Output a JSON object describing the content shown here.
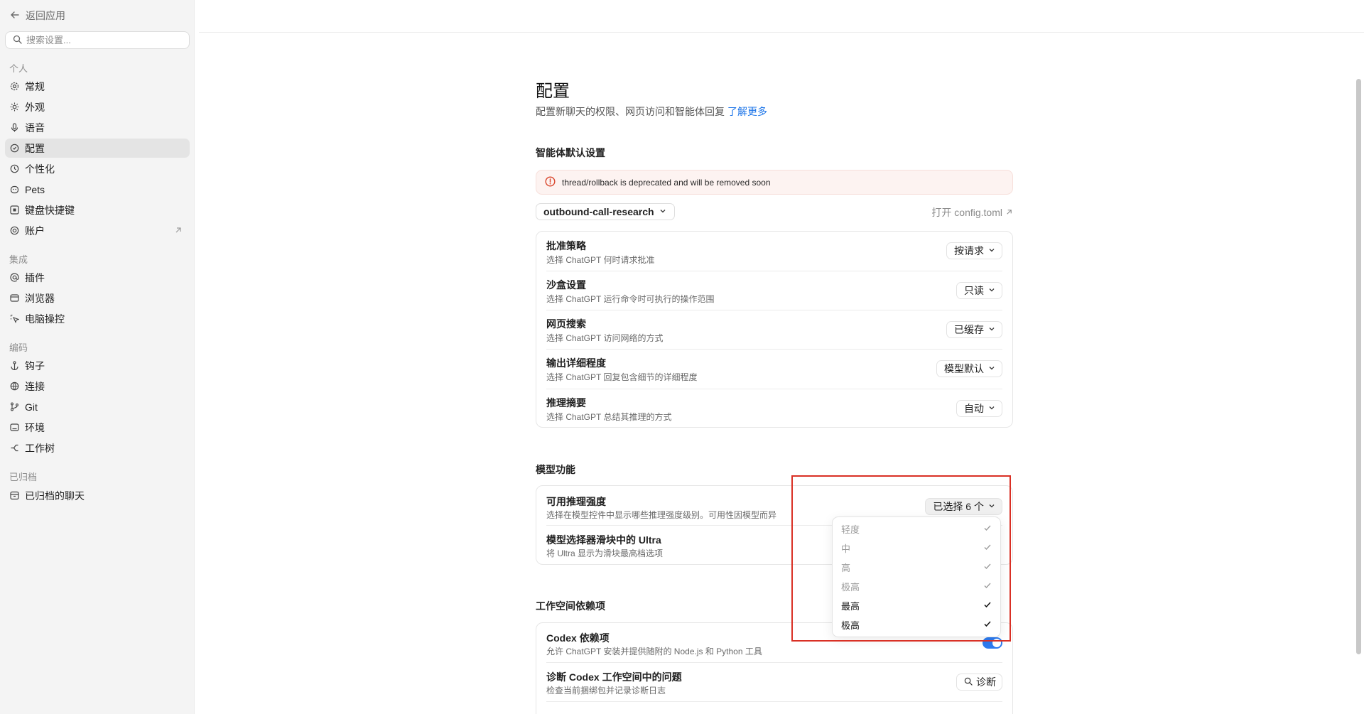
{
  "sidebar": {
    "back_label": "返回应用",
    "search_placeholder": "搜索设置...",
    "sections": {
      "personal": "个人",
      "integrations": "集成",
      "coding": "编码",
      "archived": "已归档"
    },
    "items": {
      "general": "常规",
      "appearance": "外观",
      "voice": "语音",
      "config": "配置",
      "personalization": "个性化",
      "pets": "Pets",
      "shortcuts": "键盘快捷键",
      "account": "账户",
      "plugins": "插件",
      "browser": "浏览器",
      "computer_use": "电脑操控",
      "hooks": "钩子",
      "connections": "连接",
      "git": "Git",
      "environments": "环境",
      "worktrees": "工作树",
      "archived_chats": "已归档的聊天"
    },
    "active_item": "config"
  },
  "page": {
    "title": "配置",
    "subtitle": "配置新聊天的权限、网页访问和智能体回复",
    "learn_more": "了解更多"
  },
  "agent_defaults": {
    "section_title": "智能体默认设置",
    "warning": "thread/rollback is deprecated and will be removed soon",
    "profile": "outbound-call-research",
    "open_config": "打开 config.toml",
    "rows": [
      {
        "title": "批准策略",
        "desc": "选择 ChatGPT 何时请求批准",
        "value": "按请求"
      },
      {
        "title": "沙盒设置",
        "desc": "选择 ChatGPT 运行命令时可执行的操作范围",
        "value": "只读"
      },
      {
        "title": "网页搜索",
        "desc": "选择 ChatGPT 访问网络的方式",
        "value": "已缓存"
      },
      {
        "title": "输出详细程度",
        "desc": "选择 ChatGPT 回复包含细节的详细程度",
        "value": "模型默认"
      },
      {
        "title": "推理摘要",
        "desc": "选择 ChatGPT 总结其推理的方式",
        "value": "自动"
      }
    ]
  },
  "model_features": {
    "section_title": "模型功能",
    "rows": [
      {
        "title": "可用推理强度",
        "desc": "选择在模型控件中显示哪些推理强度级别。可用性因模型而异",
        "value": "已选择 6 个"
      },
      {
        "title": "模型选择器滑块中的 Ultra",
        "desc": "将 Ultra 显示为滑块最高档选项"
      }
    ],
    "menu": [
      {
        "label": "轻度",
        "checked": true
      },
      {
        "label": "中",
        "checked": true
      },
      {
        "label": "高",
        "checked": true
      },
      {
        "label": "极高",
        "checked": true
      },
      {
        "label": "最高",
        "checked": true
      },
      {
        "label": "极高",
        "checked": true
      }
    ]
  },
  "workspace_deps": {
    "section_title": "工作空间依赖项",
    "rows": [
      {
        "title": "Codex 依赖项",
        "desc": "允许 ChatGPT 安装并提供随附的 Node.js 和 Python 工具",
        "enabled": true
      },
      {
        "title": "诊断 Codex 工作空间中的问题",
        "desc": "检查当前捆绑包并记录诊断日志",
        "value": "诊断"
      }
    ]
  },
  "colors": {
    "accent": "#2d7bf0",
    "link": "#1a73e8",
    "warning_icon": "#d9452b",
    "highlight": "#d93025"
  }
}
